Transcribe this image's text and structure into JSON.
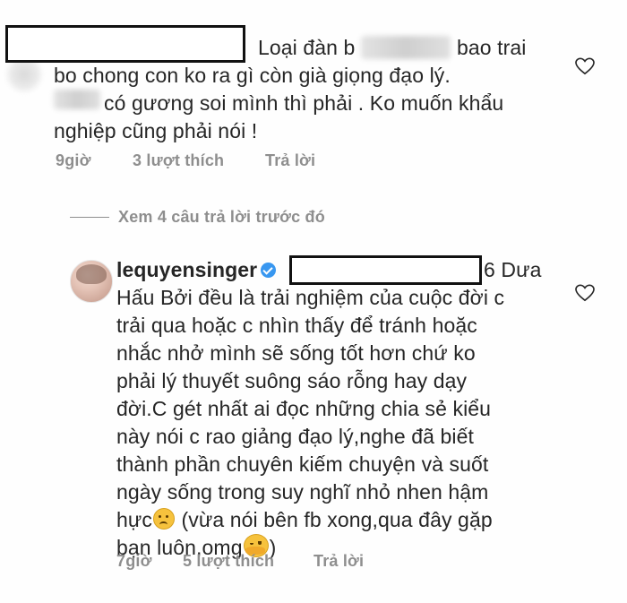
{
  "comments": [
    {
      "username": "",
      "lines": [
        "Loại đàn b",
        "bao trai",
        "bo chong con ko ra gì còn già giọng đạo lý.",
        "có gương soi mình thì phải . Ko muốn khẩu",
        "nghiệp cũng phải nói !"
      ],
      "time": "9giờ",
      "likes": "3 lượt thích",
      "reply": "Trả lời"
    },
    {
      "username": "lequyensinger",
      "verified": true,
      "lines": [
        "6 Dưa",
        "Hấu Bởi đều là trải nghiệm của cuộc đời c",
        "trải qua hoặc c nhìn thấy để tránh hoặc",
        "nhắc nhở mình sẽ sống tốt hơn chứ ko",
        "phải lý thuyết suông sáo rỗng hay dạy",
        "đời.C gét nhất ai đọc những chia sẻ kiểu",
        "này nói c rao giảng đạo lý,nghe đã biết",
        "thành phần chuyên kiếm chuyện và suốt",
        "ngày sống trong suy nghĩ nhỏ nhen hậm",
        "hực",
        "(vừa nói bên fb xong,qua đây gặp",
        "bạn luôn,omg",
        ")"
      ],
      "time": "7giờ",
      "likes": "5 lượt thích",
      "reply": "Trả lời"
    }
  ],
  "view_replies": "Xem 4 câu trả lời trước đó",
  "icons": {
    "heart": "heart-icon",
    "verified": "verified-badge-icon",
    "sad_emoji": "sad-face-emoji",
    "hug_emoji": "hugging-face-emoji"
  },
  "colors": {
    "text": "#262626",
    "meta": "#8e8e8e",
    "verified": "#3897f0"
  }
}
